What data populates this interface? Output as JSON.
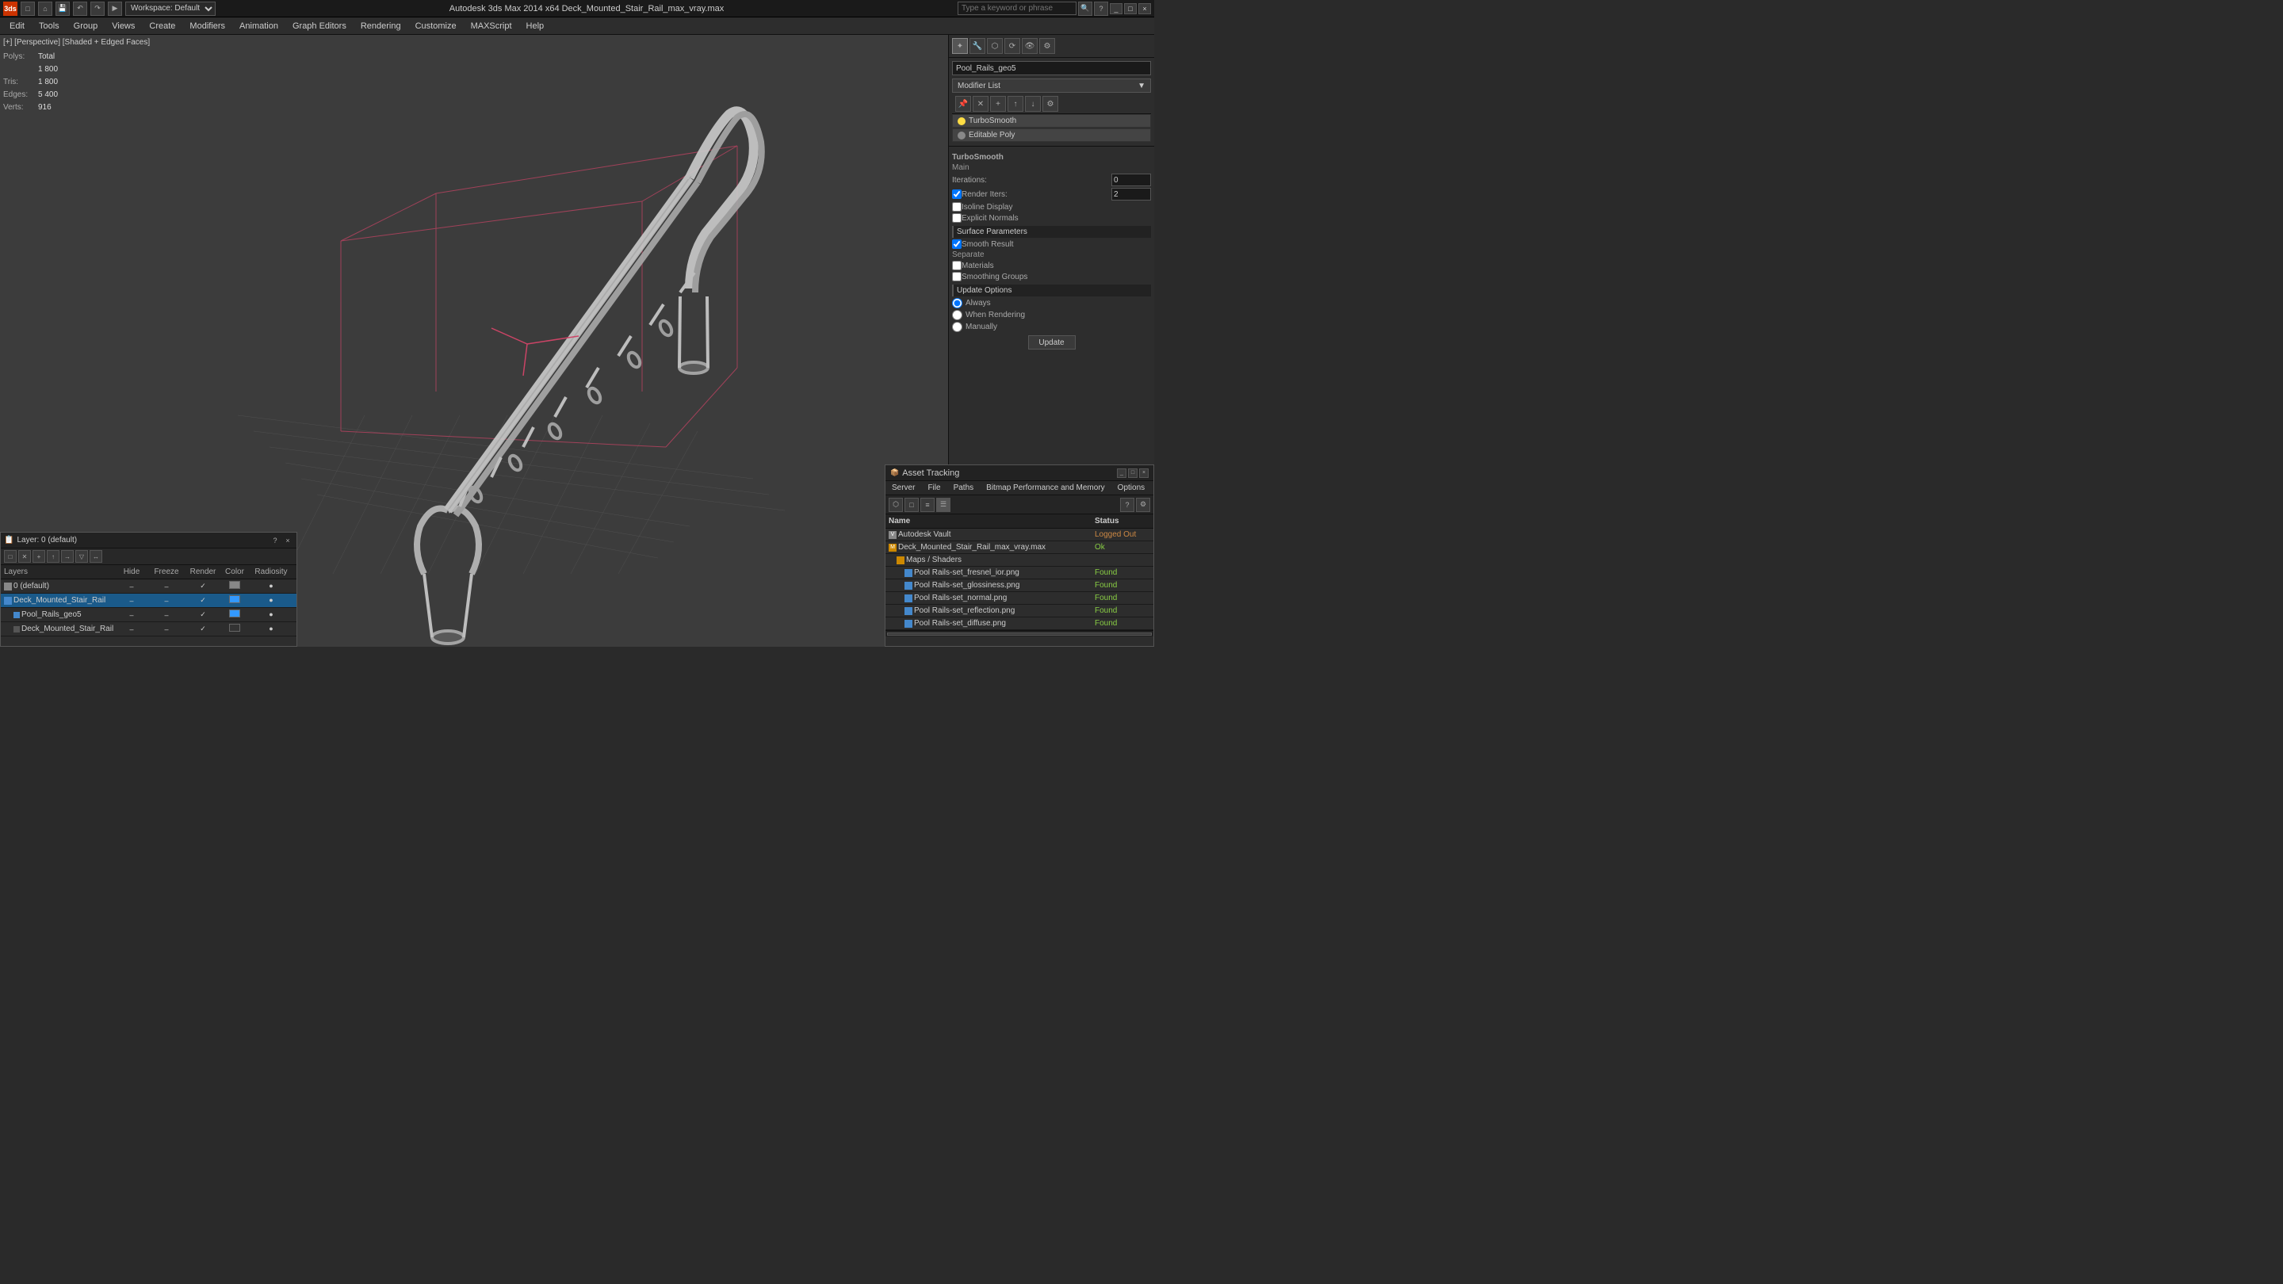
{
  "titlebar": {
    "app_logo": "3ds",
    "title": "Autodesk 3ds Max 2014 x64    Deck_Mounted_Stair_Rail_max_vray.max",
    "workspace_label": "Workspace: Default",
    "search_placeholder": "Type a keyword or phrase",
    "window_buttons": [
      "_",
      "□",
      "×"
    ]
  },
  "menubar": {
    "items": [
      "Edit",
      "Tools",
      "Group",
      "Views",
      "Create",
      "Modifiers",
      "Animation",
      "Graph Editors",
      "Rendering",
      "Customize",
      "MAXScript",
      "Help"
    ]
  },
  "viewport": {
    "label": "[+] [Perspective] [Shaded + Edged Faces]",
    "stats": {
      "polys_label": "Polys:",
      "polys_total": "Total",
      "polys_value": "1 800",
      "tris_label": "Tris:",
      "tris_value": "1 800",
      "edges_label": "Edges:",
      "edges_value": "5 400",
      "verts_label": "Verts:",
      "verts_value": "916"
    }
  },
  "right_panel": {
    "obj_name": "Pool_Rails_geo5",
    "modifier_list_label": "Modifier List",
    "modifiers": [
      {
        "name": "TurboSmooth",
        "selected": false,
        "on": true
      },
      {
        "name": "Editable Poly",
        "selected": false,
        "on": false
      }
    ],
    "selected_modifier": "TurboSmooth",
    "params": {
      "header": "TurboSmooth",
      "main_label": "Main",
      "iterations_label": "Iterations:",
      "iterations_value": "0",
      "render_iters_label": "Render Iters:",
      "render_iters_value": "2",
      "render_iters_checked": true,
      "isoline_display_label": "Isoline Display",
      "isoline_checked": false,
      "explicit_normals_label": "Explicit Normals",
      "explicit_checked": false,
      "surface_params_label": "Surface Parameters",
      "smooth_result_label": "Smooth Result",
      "smooth_checked": true,
      "separate_label": "Separate",
      "materials_label": "Materials",
      "materials_checked": false,
      "smoothing_groups_label": "Smoothing Groups",
      "smoothing_checked": false,
      "update_options_label": "Update Options",
      "always_label": "Always",
      "always_selected": true,
      "when_rendering_label": "When Rendering",
      "manually_label": "Manually",
      "update_btn": "Update"
    }
  },
  "layer_panel": {
    "title": "Layer: 0 (default)",
    "close_btn": "×",
    "question_btn": "?",
    "columns": [
      "Layers",
      "Hide",
      "Freeze",
      "Render",
      "Color",
      "Radiosity"
    ],
    "rows": [
      {
        "name": "0 (default)",
        "indent": 0,
        "selected": false,
        "hide": "–",
        "freeze": "–",
        "render": "✓",
        "color": "#888888"
      },
      {
        "name": "Deck_Mounted_Stair_Rail",
        "indent": 0,
        "selected": true,
        "hide": "–",
        "freeze": "–",
        "render": "✓",
        "color": "#3399ff"
      },
      {
        "name": "Pool_Rails_geo5",
        "indent": 1,
        "selected": false,
        "hide": "–",
        "freeze": "–",
        "render": "✓",
        "color": "#3399ff"
      },
      {
        "name": "Deck_Mounted_Stair_Rail",
        "indent": 1,
        "selected": false,
        "hide": "–",
        "freeze": "–",
        "render": "✓",
        "color": "#333333"
      }
    ]
  },
  "asset_panel": {
    "title": "Asset Tracking",
    "menu_items": [
      "Server",
      "File",
      "Paths",
      "Bitmap Performance and Memory",
      "Options"
    ],
    "columns": [
      "Name",
      "Status"
    ],
    "rows": [
      {
        "name": "Autodesk Vault",
        "indent": 0,
        "type": "vault",
        "status": "Logged Out",
        "status_class": "status-loggedout"
      },
      {
        "name": "Deck_Mounted_Stair_Rail_max_vray.max",
        "indent": 0,
        "type": "file",
        "status": "Ok",
        "status_class": "status-ok"
      },
      {
        "name": "Maps / Shaders",
        "indent": 1,
        "type": "folder",
        "status": "",
        "status_class": ""
      },
      {
        "name": "Pool Rails-set_fresnel_ior.png",
        "indent": 2,
        "type": "image",
        "status": "Found",
        "status_class": "status-found"
      },
      {
        "name": "Pool Rails-set_glossiness.png",
        "indent": 2,
        "type": "image",
        "status": "Found",
        "status_class": "status-found"
      },
      {
        "name": "Pool Rails-set_normal.png",
        "indent": 2,
        "type": "image",
        "status": "Found",
        "status_class": "status-found"
      },
      {
        "name": "Pool Rails-set_reflection.png",
        "indent": 2,
        "type": "image",
        "status": "Found",
        "status_class": "status-found"
      },
      {
        "name": "Pool Rails-set_diffuse.png",
        "indent": 2,
        "type": "image",
        "status": "Found",
        "status_class": "status-found"
      }
    ]
  }
}
